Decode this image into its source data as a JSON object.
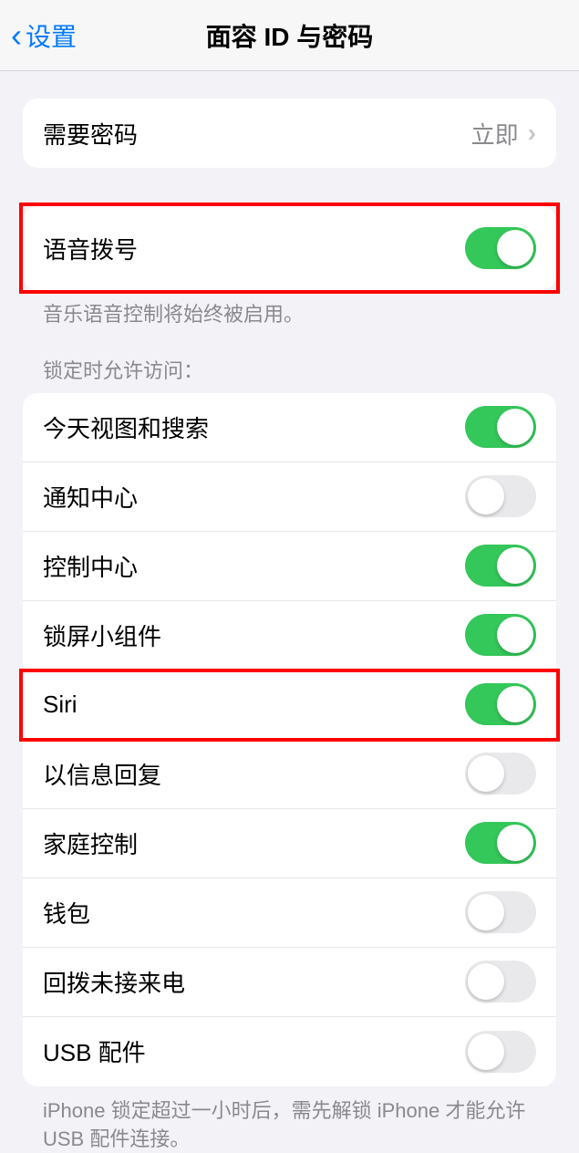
{
  "nav": {
    "back": "设置",
    "title": "面容 ID 与密码"
  },
  "passcode": {
    "label": "需要密码",
    "value": "立即"
  },
  "voiceDial": {
    "label": "语音拨号",
    "footer": "音乐语音控制将始终被启用。",
    "on": true
  },
  "lockHeader": "锁定时允许访问：",
  "lockItems": [
    {
      "label": "今天视图和搜索",
      "on": true
    },
    {
      "label": "通知中心",
      "on": false
    },
    {
      "label": "控制中心",
      "on": true
    },
    {
      "label": "锁屏小组件",
      "on": true
    },
    {
      "label": "Siri",
      "on": true
    },
    {
      "label": "以信息回复",
      "on": false
    },
    {
      "label": "家庭控制",
      "on": true
    },
    {
      "label": "钱包",
      "on": false
    },
    {
      "label": "回拨未接来电",
      "on": false
    },
    {
      "label": "USB 配件",
      "on": false
    }
  ],
  "usbFooter": "iPhone 锁定超过一小时后，需先解锁 iPhone 才能允许 USB 配件连接。"
}
